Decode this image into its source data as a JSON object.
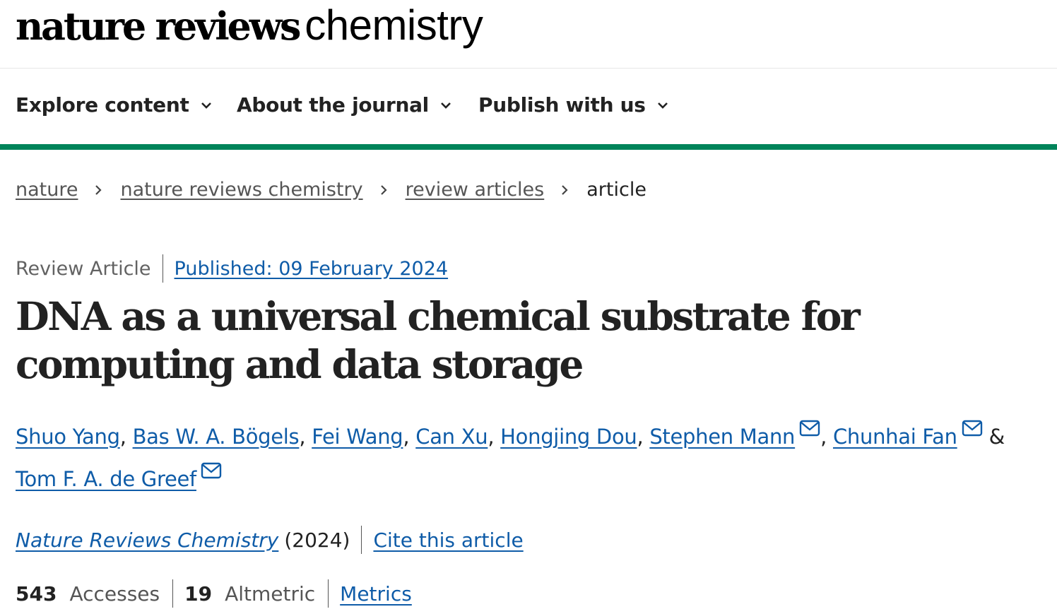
{
  "header": {
    "logo_bold": "nature reviews",
    "logo_light": "chemistry"
  },
  "nav": {
    "items": [
      {
        "label": "Explore content"
      },
      {
        "label": "About the journal"
      },
      {
        "label": "Publish with us"
      }
    ]
  },
  "breadcrumb": {
    "items": [
      "nature",
      "nature reviews chemistry",
      "review articles"
    ],
    "current": "article"
  },
  "article": {
    "type": "Review Article",
    "published": "Published: 09 February 2024",
    "title": "DNA as a universal chemical substrate for computing and data storage",
    "authors": [
      "Shuo Yang",
      "Bas W. A. Bögels",
      "Fei Wang",
      "Can Xu",
      "Hongjing Dou",
      "Stephen Mann",
      "Chunhai Fan",
      "Tom F. A. de Greef"
    ],
    "authors_with_email": [
      "Stephen Mann",
      "Chunhai Fan",
      "Tom F. A. de Greef"
    ],
    "author_last_separator": "&",
    "journal": "Nature Reviews Chemistry",
    "year": "(2024)",
    "cite": "Cite this article"
  },
  "metrics": {
    "accesses_value": "543",
    "accesses_label": "Accesses",
    "altmetric_value": "19",
    "altmetric_label": "Altmetric",
    "metrics_link": "Metrics"
  },
  "colors": {
    "accent_green": "#00845a",
    "link_blue": "#0f5ca8",
    "text_dark": "#222222"
  },
  "icons": {
    "nav_chevron": "chevron-down-icon",
    "breadcrumb_separator": "chevron-right-icon",
    "author_email": "mail-icon"
  }
}
